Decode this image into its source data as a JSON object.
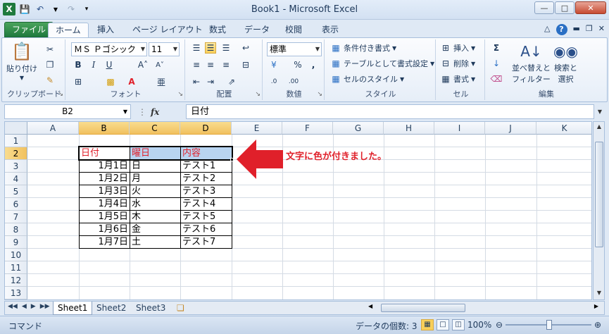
{
  "window": {
    "title": "Book1 - Microsoft Excel"
  },
  "ribbon_tabs": [
    "ファイル",
    "ホーム",
    "挿入",
    "ページ レイアウト",
    "数式",
    "データ",
    "校閲",
    "表示"
  ],
  "ribbon": {
    "clipboard": {
      "label": "クリップボード",
      "paste": "貼り付け"
    },
    "font": {
      "label": "フォント",
      "name": "ＭＳ Ｐゴシック",
      "size": "11"
    },
    "alignment": {
      "label": "配置"
    },
    "number": {
      "label": "数値",
      "format": "標準"
    },
    "styles": {
      "label": "スタイル",
      "conditional": "条件付き書式",
      "table": "テーブルとして書式設定",
      "cell": "セルのスタイル"
    },
    "cells": {
      "label": "セル",
      "insert": "挿入",
      "delete": "削除",
      "format": "書式"
    },
    "editing": {
      "label": "編集",
      "sort1": "並べ替えと",
      "sort2": "フィルター",
      "find1": "検索と",
      "find2": "選択"
    }
  },
  "formula_bar": {
    "name_box": "B2",
    "fx": "fx",
    "value": "日付"
  },
  "grid": {
    "columns": [
      "A",
      "B",
      "C",
      "D",
      "E",
      "F",
      "G",
      "H",
      "I",
      "J",
      "K"
    ],
    "rows": [
      "1",
      "2",
      "3",
      "4",
      "5",
      "6",
      "7",
      "8",
      "9",
      "10",
      "11",
      "12",
      "13"
    ],
    "headers": [
      "日付",
      "曜日",
      "内容"
    ],
    "data": [
      [
        "1月1日",
        "日",
        "テスト1"
      ],
      [
        "1月2日",
        "月",
        "テスト2"
      ],
      [
        "1月3日",
        "火",
        "テスト3"
      ],
      [
        "1月4日",
        "水",
        "テスト4"
      ],
      [
        "1月5日",
        "木",
        "テスト5"
      ],
      [
        "1月6日",
        "金",
        "テスト6"
      ],
      [
        "1月7日",
        "土",
        "テスト7"
      ]
    ]
  },
  "annotation": "文字に色が付きました。",
  "sheets": [
    "Sheet1",
    "Sheet2",
    "Sheet3"
  ],
  "status": {
    "mode": "コマンド",
    "count": "データの個数: 3",
    "zoom": "100%"
  },
  "colors": {
    "header_text": "#e0202a",
    "header_fill": "#b8d4f0",
    "arrow": "#e0202a"
  }
}
